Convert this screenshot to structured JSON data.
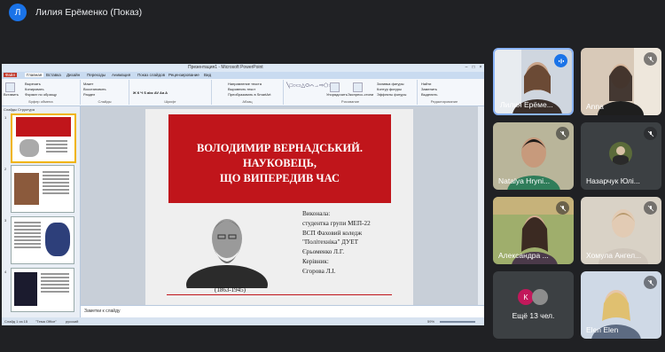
{
  "meeting": {
    "presenter_initial": "Л",
    "title": "Лилия Ерёменко (Показ)"
  },
  "ppt": {
    "window_title": "Презентация1 - Microsoft PowerPoint",
    "tabs": [
      "Файл",
      "Главная",
      "Вставка",
      "Дизайн",
      "Переходы",
      "Анимация",
      "Показ слайдов",
      "Рецензирование",
      "Вид"
    ],
    "ribbon": {
      "paste": "Вставить",
      "cut": "Вырезать",
      "copy": "Копировать",
      "format_painter": "Формат по образцу",
      "clipboard": "Буфер обмена",
      "new_slide": "Макет",
      "reset": "Восстановить",
      "section": "Раздел",
      "slides": "Слайды",
      "font": "Шрифт",
      "paragraph": "Абзац",
      "text_direction": "Направление текста",
      "align_text": "Выровнять текст",
      "smartart": "Преобразовать в SmartArt",
      "arrange": "Упорядочить",
      "quick_styles": "Экспресс-стили",
      "shape_fill": "Заливка фигуры",
      "shape_outline": "Контур фигуры",
      "shape_effects": "Эффекты фигуры",
      "drawing": "Рисование",
      "find": "Найти",
      "replace": "Заменить",
      "select": "Выделить",
      "editing": "Редактирование"
    },
    "thumb_tabs": "Слайды   Структура",
    "slide_numbers": [
      "1",
      "2",
      "3",
      "4"
    ],
    "slide": {
      "title_lines": [
        "ВОЛОДИМИР ВЕРНАДСЬКИЙ.",
        "НАУКОВЕЦЬ,",
        "ЩО ВИПЕРЕДИВ ЧАС"
      ],
      "years": "(1863-1945)",
      "info_lines": [
        "Виконала:",
        "студентка групи МЕП-22",
        "ВСП Фаховий коледж",
        "\"Політехніка\" ДУЕТ",
        "Єрьоменко Л.Г.",
        "Керівник:",
        "Єгорова Л.І."
      ]
    },
    "notes_placeholder": "Заметки к слайду",
    "status": {
      "slide_counter": "Слайд 1 из 15",
      "theme": "\"Тема Office\"",
      "language": "русский",
      "zoom": "59%"
    }
  },
  "participants": [
    {
      "name": "Лилия Ерёме...",
      "speaking": true
    },
    {
      "name": "Anna",
      "speaking": false
    },
    {
      "name": "Natalya Hryni...",
      "speaking": false
    },
    {
      "name": "Назарчук Юлі...",
      "speaking": false
    },
    {
      "name": "Александра ...",
      "speaking": false
    },
    {
      "name": "Хомула Ангел...",
      "speaking": false
    },
    {
      "name": "Elen Elen",
      "speaking": false
    }
  ],
  "more": {
    "initial": "K",
    "label": "Ещё 13 чел."
  }
}
